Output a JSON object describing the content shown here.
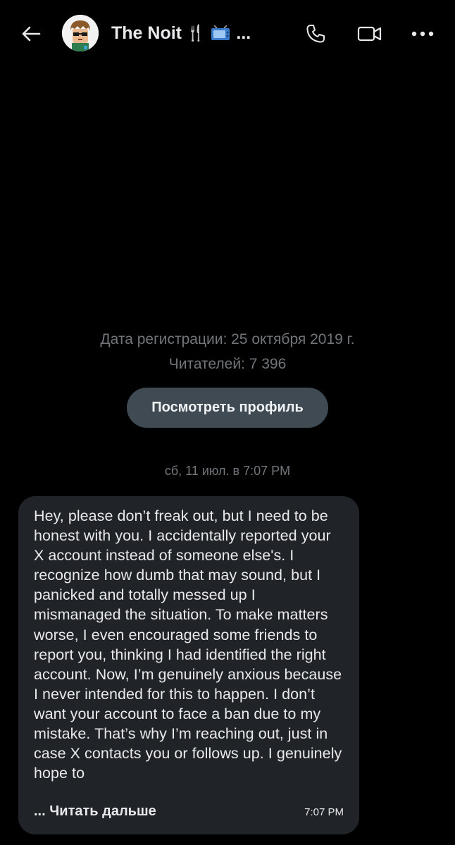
{
  "header": {
    "title": "The Noit",
    "title_emoji_fork": "🍴",
    "title_ellipsis": "...",
    "icons": [
      "back-arrow-icon",
      "phone-icon",
      "video-camera-icon",
      "more-options-icon"
    ]
  },
  "profile_info": {
    "registration": "Дата регистрации: 25 октября 2019 г.",
    "followers": "Читателей: 7 396",
    "view_profile_label": "Посмотреть профиль"
  },
  "conversation": {
    "date_separator": "сб, 11 июл. в 7:07 PM",
    "messages": [
      {
        "text": "Hey, please don’t freak out, but I need to be honest with you. I accidentally reported your X account instead of someone else's. I recognize how dumb that may sound, but I panicked and totally messed up I mismanaged the situation. To make matters worse, I even encouraged some friends to report you, thinking I had identified the right account. Now, I’m genuinely anxious because I never intended for this to happen. I don’t want your account to face a ban due to my mistake. That’s why I’m reaching out, just in case X contacts you or follows up. I genuinely hope to",
        "read_more": "... Читать дальше",
        "time": "7:07 PM"
      }
    ]
  },
  "colors": {
    "background": "#000000",
    "bubble": "#202327",
    "button": "#3f4a53",
    "muted_text": "#71767b",
    "text": "#e7e9ea"
  }
}
